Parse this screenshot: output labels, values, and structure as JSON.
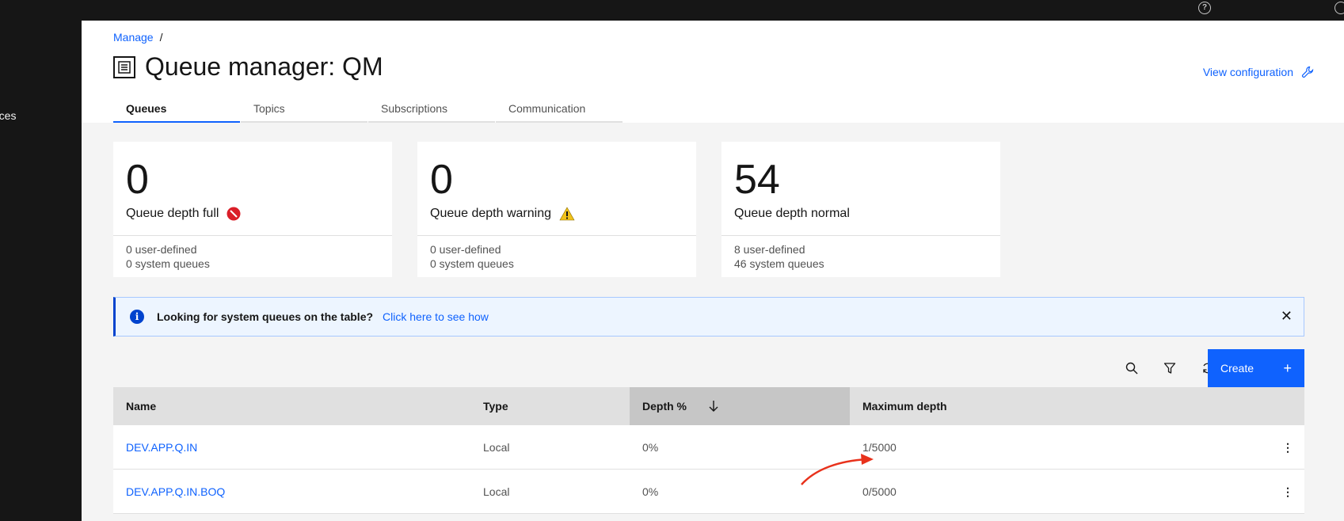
{
  "breadcrumb": {
    "link": "Manage",
    "separator": "/"
  },
  "page": {
    "title": "Queue manager: QM"
  },
  "header": {
    "view_config": "View configuration"
  },
  "sidenav": {
    "partial_item": "rces"
  },
  "tabs": [
    {
      "label": "Queues",
      "active": true
    },
    {
      "label": "Topics",
      "active": false
    },
    {
      "label": "Subscriptions",
      "active": false
    },
    {
      "label": "Communication",
      "active": false
    }
  ],
  "tiles": [
    {
      "value": "0",
      "label": "Queue depth full",
      "status": "error",
      "user_defined": "0  user-defined",
      "system": "0  system queues"
    },
    {
      "value": "0",
      "label": "Queue depth warning",
      "status": "warning",
      "user_defined": "0  user-defined",
      "system": "0  system queues"
    },
    {
      "value": "54",
      "label": "Queue depth normal",
      "status": "normal",
      "user_defined": "8  user-defined",
      "system": "46  system queues"
    }
  ],
  "notice": {
    "title": "Looking for system queues on the table?",
    "link": "Click here to see how"
  },
  "toolbar": {
    "create_label": "Create"
  },
  "table": {
    "columns": [
      "Name",
      "Type",
      "Depth %",
      "Maximum depth"
    ],
    "sorted_column": "Depth %",
    "rows": [
      {
        "name": "DEV.APP.Q.IN",
        "type": "Local",
        "depth": "0%",
        "max_depth": "1/5000"
      },
      {
        "name": "DEV.APP.Q.IN.BOQ",
        "type": "Local",
        "depth": "0%",
        "max_depth": "0/5000"
      }
    ]
  },
  "colors": {
    "accent": "#0f62fe",
    "error": "#da1e28",
    "warning": "#f1c21b",
    "annotation": "#e8321c"
  }
}
